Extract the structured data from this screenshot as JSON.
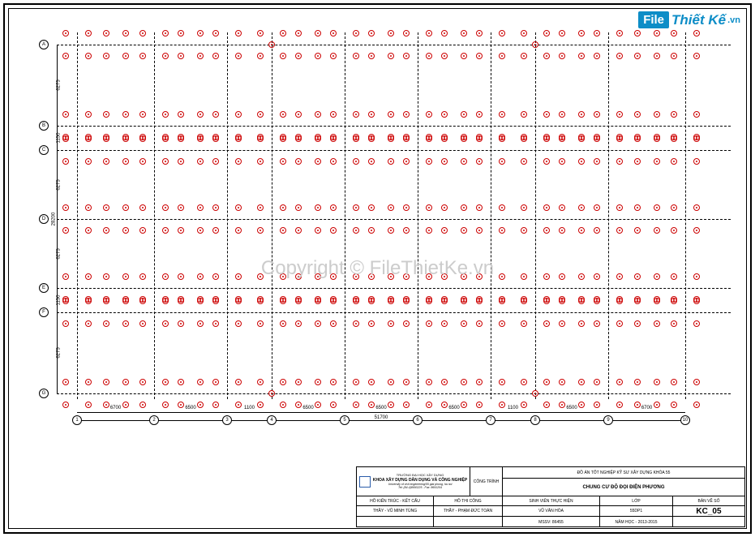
{
  "watermark": {
    "logo_file": "File",
    "logo_thietke": "Thiết Kế",
    "logo_vn": ".vn",
    "copyright": "Copyright © FileThietKe.vn"
  },
  "grid": {
    "h_axes": [
      "A",
      "B",
      "C",
      "D",
      "E",
      "F",
      "G"
    ],
    "h_positions": [
      25,
      125,
      155,
      240,
      325,
      355,
      455
    ],
    "v_axes": [
      "1",
      "2",
      "3",
      "4",
      "5",
      "6",
      "7",
      "8",
      "9",
      "10"
    ],
    "v_positions": [
      65,
      160,
      250,
      305,
      395,
      485,
      575,
      630,
      720,
      815
    ],
    "h_dims": [
      "6275",
      "1150",
      "6275",
      "6275",
      "1150",
      "6275"
    ],
    "h_total": "28200",
    "v_dims": [
      "6700",
      "6500",
      "1100",
      "6500",
      "6500",
      "6500",
      "1100",
      "6500",
      "6700"
    ],
    "v_total": "51700"
  },
  "title_block": {
    "school": "TRƯỜNG ĐẠI HỌC XÂY DỰNG",
    "dept": "KHOA XÂY DỰNG DÂN DỤNG VÀ CÔNG NGHIỆP",
    "addr": "University of civil engineering/55 giai phong, ha noi",
    "tel": "Tel: (84-4)8693225 - Fax: 8691204",
    "project_label": "CÔNG TRÌNH",
    "doc_type": "ĐỒ ÁN TỐT NGHIỆP KỸ SƯ XÂY DỰNG KHÓA 55",
    "project_name": "CHUNG CƯ ĐỘ ĐỌI ĐIỆN PHƯƠNG",
    "h_gvkt": "HỒ KIẾN TRÚC - KẾT CẤU",
    "h_gvtc": "HỒ THI CÔNG",
    "h_student": "SINH VIÊN THỰC HIỆN",
    "h_class": "LỚP",
    "h_sheet": "BẢN VẼ SỐ",
    "gv1": "THẦY - VŨ MINH TÙNG",
    "gv2": "THẦY - PHẠM ĐỨC TOÀN",
    "student": "VŨ VĂN HÒA",
    "class": "55DP1",
    "mssv_label": "MSSV: 86455",
    "year": "NĂM HỌC - 2013-2015",
    "sheet_no": "KC_05"
  }
}
